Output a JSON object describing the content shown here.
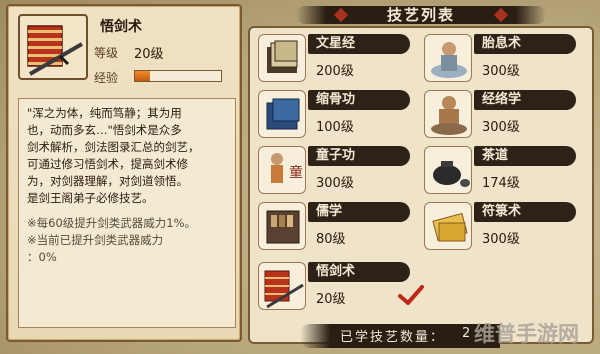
{
  "selected_skill": {
    "name": "悟剑术",
    "level_label": "等级",
    "level_value": "20级",
    "xp_label": "经验",
    "xp_progress": 0.18,
    "description": "\"浑之为体，纯而笃静；其为用\n也，动而多玄…\"悟剑术是众多\n剑术解析，剑法图录汇总的剑艺，\n可通过修习悟剑术，提高剑术修\n为，对剑器理解，对剑道领悟。\n是剑王阁弟子必修技艺。",
    "bonus": "※每60级提升剑类武器威力1%。\n※当前已提升剑类武器威力\n：0%"
  },
  "skill_list": {
    "title": "技艺列表",
    "items": [
      {
        "name": "文星经",
        "level": "200级",
        "icon": "book-stack-icon"
      },
      {
        "name": "胎息术",
        "level": "300级",
        "icon": "meditating-monk-icon"
      },
      {
        "name": "缩骨功",
        "level": "100级",
        "icon": "blue-scroll-book-icon"
      },
      {
        "name": "经络学",
        "level": "300级",
        "icon": "seated-martial-artist-icon"
      },
      {
        "name": "童子功",
        "level": "300级",
        "icon": "child-martial-artist-icon"
      },
      {
        "name": "茶道",
        "level": "174级",
        "icon": "teapot-icon"
      },
      {
        "name": "儒学",
        "level": "80级",
        "icon": "bookshelf-icon"
      },
      {
        "name": "符箓术",
        "level": "300级",
        "icon": "talisman-icon"
      },
      {
        "name": "悟剑术",
        "level": "20级",
        "icon": "sword-manual-icon",
        "checked": true
      }
    ]
  },
  "footer": {
    "learned_label": "已学技艺数量：",
    "learned_value": "2"
  },
  "watermark": "维普手游网",
  "colors": {
    "panel_dark": "#2d2218",
    "parchment": "#efe4c9",
    "accent_red": "#a8321f",
    "xp_orange": "#e07a22",
    "check_red": "#c0281a"
  }
}
